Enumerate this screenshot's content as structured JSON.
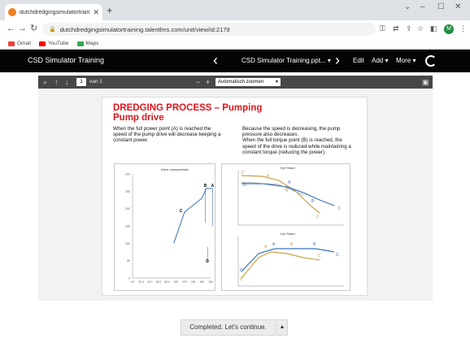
{
  "browser": {
    "tab_title": "dutchdredgingsimulatortraining",
    "tab_close": "✕",
    "new_tab": "+",
    "url": "dutchdredgingsimulatortraining.talentlms.com/unit/view/id:2179",
    "bookmarks": [
      {
        "label": "Gmail",
        "color": "#ea4335"
      },
      {
        "label": "YouTube",
        "color": "#ff0000"
      },
      {
        "label": "Maps",
        "color": "#34a853"
      }
    ],
    "profile_initial": "M"
  },
  "app": {
    "title": "CSD Simulator Training",
    "course_title": "CSD Simulator Training.ppt... ▾",
    "menu": {
      "edit": "Edit",
      "add": "Add ▾",
      "more": "More ▾"
    }
  },
  "pdf": {
    "page_number": "1",
    "page_of": "van 1",
    "zoom": "Automatisch zoomen",
    "zoom_out": "−",
    "zoom_in": "+"
  },
  "slide": {
    "title_line1": "DREDGING PROCESS – Pumping",
    "title_line2": "Pump drive",
    "text_left": [
      "When the full power point (A) is reached the",
      "speed of the pump drive will decrease keeping a",
      "constant power."
    ],
    "text_right": [
      "Because the speed is decreasing, the pump",
      "pressure also decreases.",
      "When the full torque point (B) is reached, the",
      "speed of the drive is reduced while maintaining a",
      "constant torque (reducing the power)."
    ]
  },
  "chart_data": [
    {
      "type": "line",
      "title": "Drive characteristic",
      "x_ticks": [
        "0.0",
        "20.0",
        "40.0",
        "60.0",
        "80.0",
        "100",
        "120",
        "140",
        "160",
        "180"
      ],
      "y_ticks": [
        "0",
        "50",
        "100",
        "150",
        "200",
        "250",
        "300"
      ],
      "series": [
        {
          "values": [
            [
              95,
              100
            ],
            [
              120,
              190
            ],
            [
              140,
              210
            ],
            [
              160,
              230
            ],
            [
              170,
              258
            ],
            [
              185,
              258
            ]
          ]
        }
      ],
      "points": [
        {
          "label": "A",
          "x": 185,
          "y": 258
        },
        {
          "label": "B",
          "x": 168,
          "y": 258
        },
        {
          "label": "C",
          "x": 112,
          "y": 185
        },
        {
          "label": "D",
          "x": 173,
          "y": 40
        }
      ],
      "xlim": [
        0,
        180
      ],
      "ylim": [
        0,
        300
      ],
      "color": "#3b73b9"
    },
    {
      "type": "line",
      "title": "Kpt Share",
      "points": [
        "D",
        "A",
        "B",
        "C"
      ],
      "colors": [
        "#3b73b9",
        "#c9a24a",
        "#9aa0a6"
      ]
    },
    {
      "type": "line",
      "title": "Kpt Share",
      "points": [
        "D",
        "A",
        "B",
        "C"
      ],
      "colors": [
        "#3b73b9",
        "#c9a24a",
        "#9aa0a6"
      ]
    }
  ],
  "footer": {
    "complete_label": "Completed. Let's continue.",
    "menu_arrow": "▲"
  }
}
